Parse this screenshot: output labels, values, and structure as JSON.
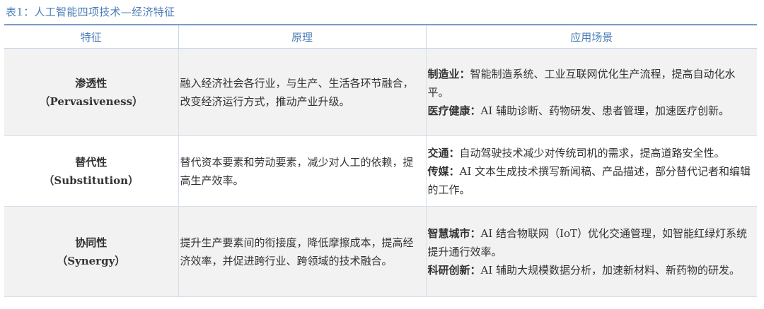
{
  "caption": "表1：人工智能四项技术—经济特征",
  "headers": [
    "特征",
    "原理",
    "应用场景"
  ],
  "rows": [
    {
      "feature_cn": "渗透性",
      "feature_en": "（Pervasiveness）",
      "principle": "融入经济社会各行业，与生产、生活各环节融合，改变经济运行方式，推动产业升级。",
      "apps": [
        {
          "label": "制造业：",
          "text": "智能制造系统、工业互联网优化生产流程，提高自动化水平。"
        },
        {
          "label": "医疗健康：",
          "text": "AI 辅助诊断、药物研发、患者管理，加速医疗创新。"
        }
      ]
    },
    {
      "feature_cn": "替代性",
      "feature_en": "（Substitution）",
      "principle": "替代资本要素和劳动要素，减少对人工的依赖，提高生产效率。",
      "apps": [
        {
          "label": "交通：",
          "text": "自动驾驶技术减少对传统司机的需求，提高道路安全性。"
        },
        {
          "label": "传媒：",
          "text": "AI 文本生成技术撰写新闻稿、产品描述，部分替代记者和编辑的工作。"
        }
      ]
    },
    {
      "feature_cn": "协同性",
      "feature_en": "（Synergy）",
      "principle": "提升生产要素间的衔接度，降低摩擦成本，提高经济效率，并促进跨行业、跨领域的技术融合。",
      "apps": [
        {
          "label": "智慧城市：",
          "text": "AI 结合物联网（IoT）优化交通管理，如智能红绿灯系统提升通行效率。"
        },
        {
          "label": "科研创新：",
          "text": "AI 辅助大规模数据分析，加速新材料、新药物的研发。"
        }
      ]
    }
  ]
}
